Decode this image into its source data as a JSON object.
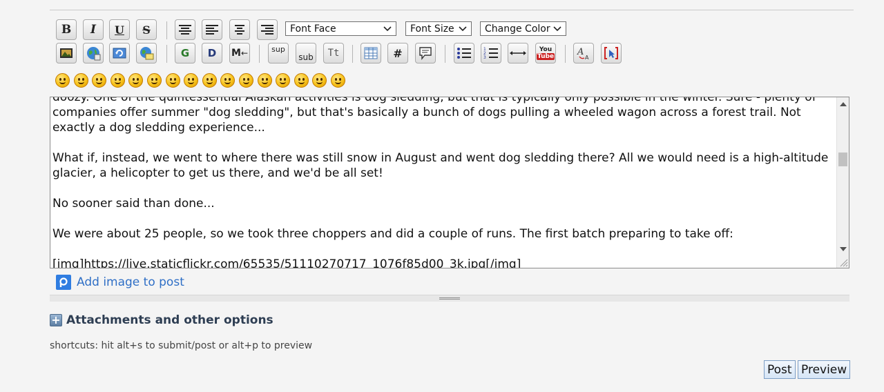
{
  "toolbar": {
    "row1": [
      {
        "name": "bold-button",
        "label": "B"
      },
      {
        "name": "italic-button",
        "label": "I"
      },
      {
        "name": "underline-button",
        "label": "U"
      },
      {
        "name": "strikethrough-button",
        "label": "S"
      },
      {
        "name": "align-center-button",
        "icon": "align-center-icon"
      },
      {
        "name": "align-left-button",
        "icon": "align-left-icon"
      },
      {
        "name": "align-middle-button",
        "icon": "align-middle-icon"
      },
      {
        "name": "align-right-button",
        "icon": "align-right-icon"
      }
    ],
    "dropdowns": {
      "font_face": "Font Face",
      "font_size": "Font Size",
      "change_color": "Change Color"
    },
    "row2_labels": {
      "google": "G",
      "dictionary": "D",
      "more": "M",
      "sup": "sup",
      "sub": "sub",
      "typewriter": "Tt",
      "hash": "#",
      "youtube_top": "You",
      "youtube_bottom": "Tube"
    }
  },
  "smilies_count": 16,
  "editor": {
    "text": "doozy. One of the quintessential Alaskan activities is dog sledding, but that is typically only possible in the winter. Sure - plenty of companies offer summer \"dog sledding\", but that's basically a bunch of dogs pulling a wheeled wagon across a forest trail. Not exactly a dog sledding experience...\n\nWhat if, instead, we went to where there was still snow in August and went dog sledding there? All we would need is a high-altitude glacier, a helicopter to get us there, and we'd be all set!\n\nNo sooner said than done...\n\nWe were about 25 people, so we took three choppers and did a couple of runs. The first batch preparing to take off:\n\n[img]https://live.staticflickr.com/65535/51110270717_1076f85d00_3k.jpg[/img]"
  },
  "add_image": "Add image to post",
  "attachments": "Attachments and other options",
  "shortcuts": "shortcuts: hit alt+s to submit/post or alt+p to preview",
  "buttons": {
    "post": "Post",
    "preview": "Preview"
  },
  "colors": {
    "link": "#2f6fc6",
    "button_bg": "#d6e5f6",
    "youtube": "#cc2222"
  }
}
